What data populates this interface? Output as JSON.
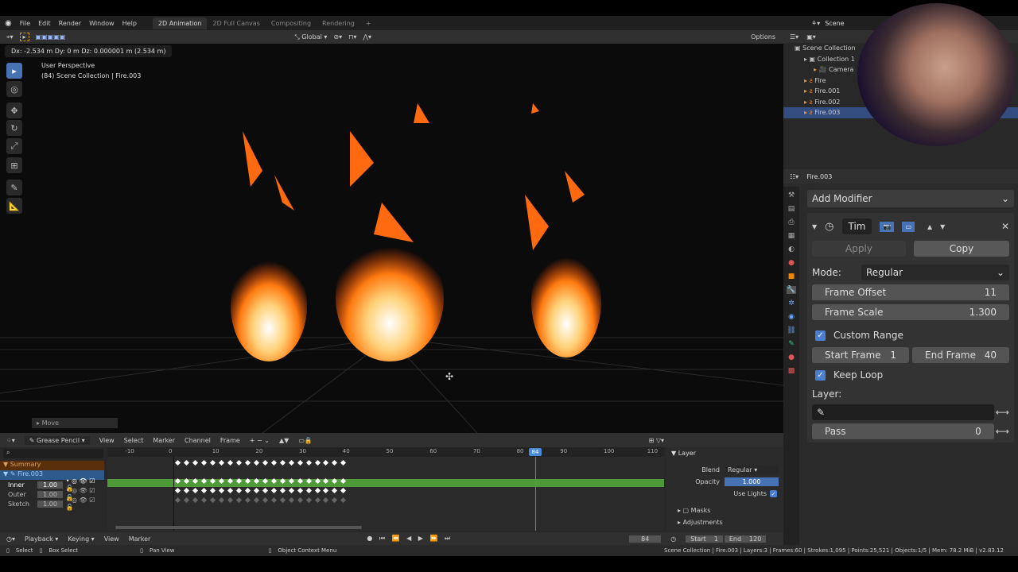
{
  "menu": [
    "File",
    "Edit",
    "Render",
    "Window",
    "Help"
  ],
  "workspaces": [
    {
      "label": "2D Animation",
      "active": true
    },
    {
      "label": "2D Full Canvas"
    },
    {
      "label": "Compositing"
    },
    {
      "label": "Rendering"
    }
  ],
  "add_workspace": "+",
  "header": {
    "orientation": "Global",
    "options": "Options"
  },
  "viewport": {
    "delta": "Dx: -2.534 m  Dy: 0 m  Dz: 0.000001 m (2.534 m)",
    "perspective": "User Perspective",
    "context": "(84) Scene Collection | Fire.003",
    "last_op": "Move"
  },
  "scene": {
    "label": "Scene"
  },
  "outliner": {
    "items": [
      {
        "label": "Scene Collection",
        "indent": 0
      },
      {
        "label": "Collection 1",
        "indent": 1
      },
      {
        "label": "Camera",
        "indent": 2
      },
      {
        "label": "Fire",
        "indent": 1
      },
      {
        "label": "Fire.001",
        "indent": 1
      },
      {
        "label": "Fire.002",
        "indent": 1
      },
      {
        "label": "Fire.003",
        "indent": 1,
        "selected": true
      }
    ]
  },
  "properties": {
    "object": "Fire.003",
    "add_modifier": "Add Modifier",
    "modifier_name": "Tim",
    "apply": "Apply",
    "copy": "Copy",
    "mode_label": "Mode:",
    "mode_value": "Regular",
    "frame_offset_label": "Frame Offset",
    "frame_offset": "11",
    "frame_scale_label": "Frame Scale",
    "frame_scale": "1.300",
    "custom_range_label": "Custom Range",
    "custom_range": true,
    "start_frame_label": "Start Frame",
    "start_frame": "1",
    "end_frame_label": "End Frame",
    "end_frame": "40",
    "keep_loop_label": "Keep Loop",
    "keep_loop": true,
    "layer_label": "Layer:",
    "pass_label": "Pass",
    "pass_value": "0"
  },
  "dopesheet": {
    "mode": "Grease Pencil",
    "menus": [
      "View",
      "Select",
      "Marker",
      "Channel",
      "Frame"
    ],
    "ruler": [
      "-10",
      "0",
      "10",
      "20",
      "30",
      "40",
      "50",
      "60",
      "70",
      "80",
      "90",
      "100",
      "110"
    ],
    "current_frame": "84",
    "summary": "Summary",
    "object": "Fire.003",
    "layers": [
      {
        "name": "Inner",
        "opacity": "1.00"
      },
      {
        "name": "Outer",
        "opacity": "1.00"
      },
      {
        "name": "Sketch",
        "opacity": "1.00"
      }
    ],
    "side": {
      "title": "Layer",
      "blend_label": "Blend",
      "blend": "Regular",
      "opacity_label": "Opacity",
      "opacity": "1.000",
      "use_lights": "Use Lights",
      "masks": "Masks",
      "adjustments": "Adjustments"
    }
  },
  "timeline": {
    "menus": [
      "Playback",
      "Keying",
      "View",
      "Marker"
    ],
    "frame": "84",
    "start_label": "Start",
    "start": "1",
    "end_label": "End",
    "end": "120"
  },
  "status": {
    "select": "Select",
    "box_select": "Box Select",
    "pan": "Pan View",
    "context_menu": "Object Context Menu",
    "info": "Scene Collection | Fire.003 | Layers:3 | Frames:60 | Strokes:1,095 | Points:25,521 | Objects:1/5 | Mem: 78.2 MiB | v2.83.12"
  }
}
